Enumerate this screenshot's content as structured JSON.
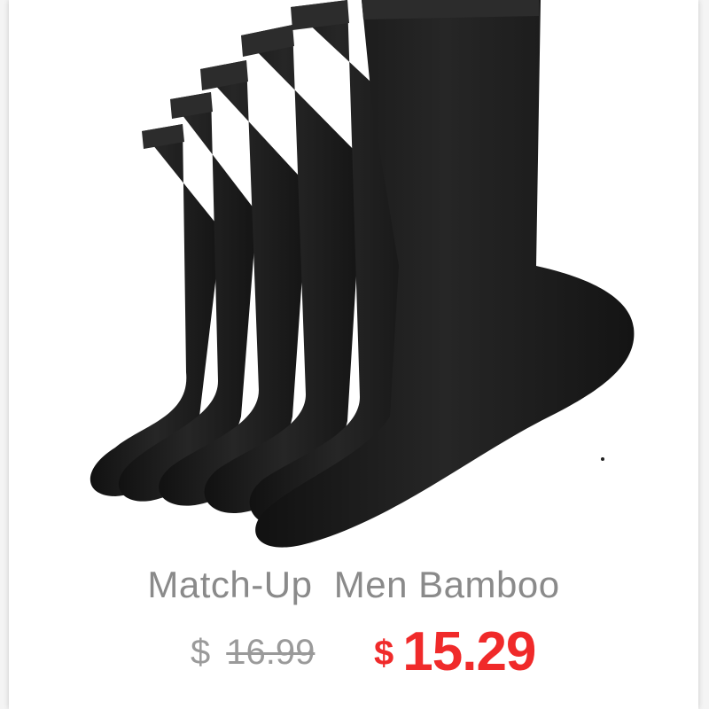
{
  "product": {
    "title": "Match-Up  Men Bamboo",
    "image_icon": "black-socks-image",
    "old_price": {
      "currency": "$",
      "amount": "16.99"
    },
    "new_price": {
      "currency": "$",
      "amount": "15.29"
    }
  },
  "colors": {
    "title": "#8a8a8a",
    "old_price": "#9a9a9a",
    "new_price": "#f02a2a",
    "sock": "#1a1a1a"
  }
}
